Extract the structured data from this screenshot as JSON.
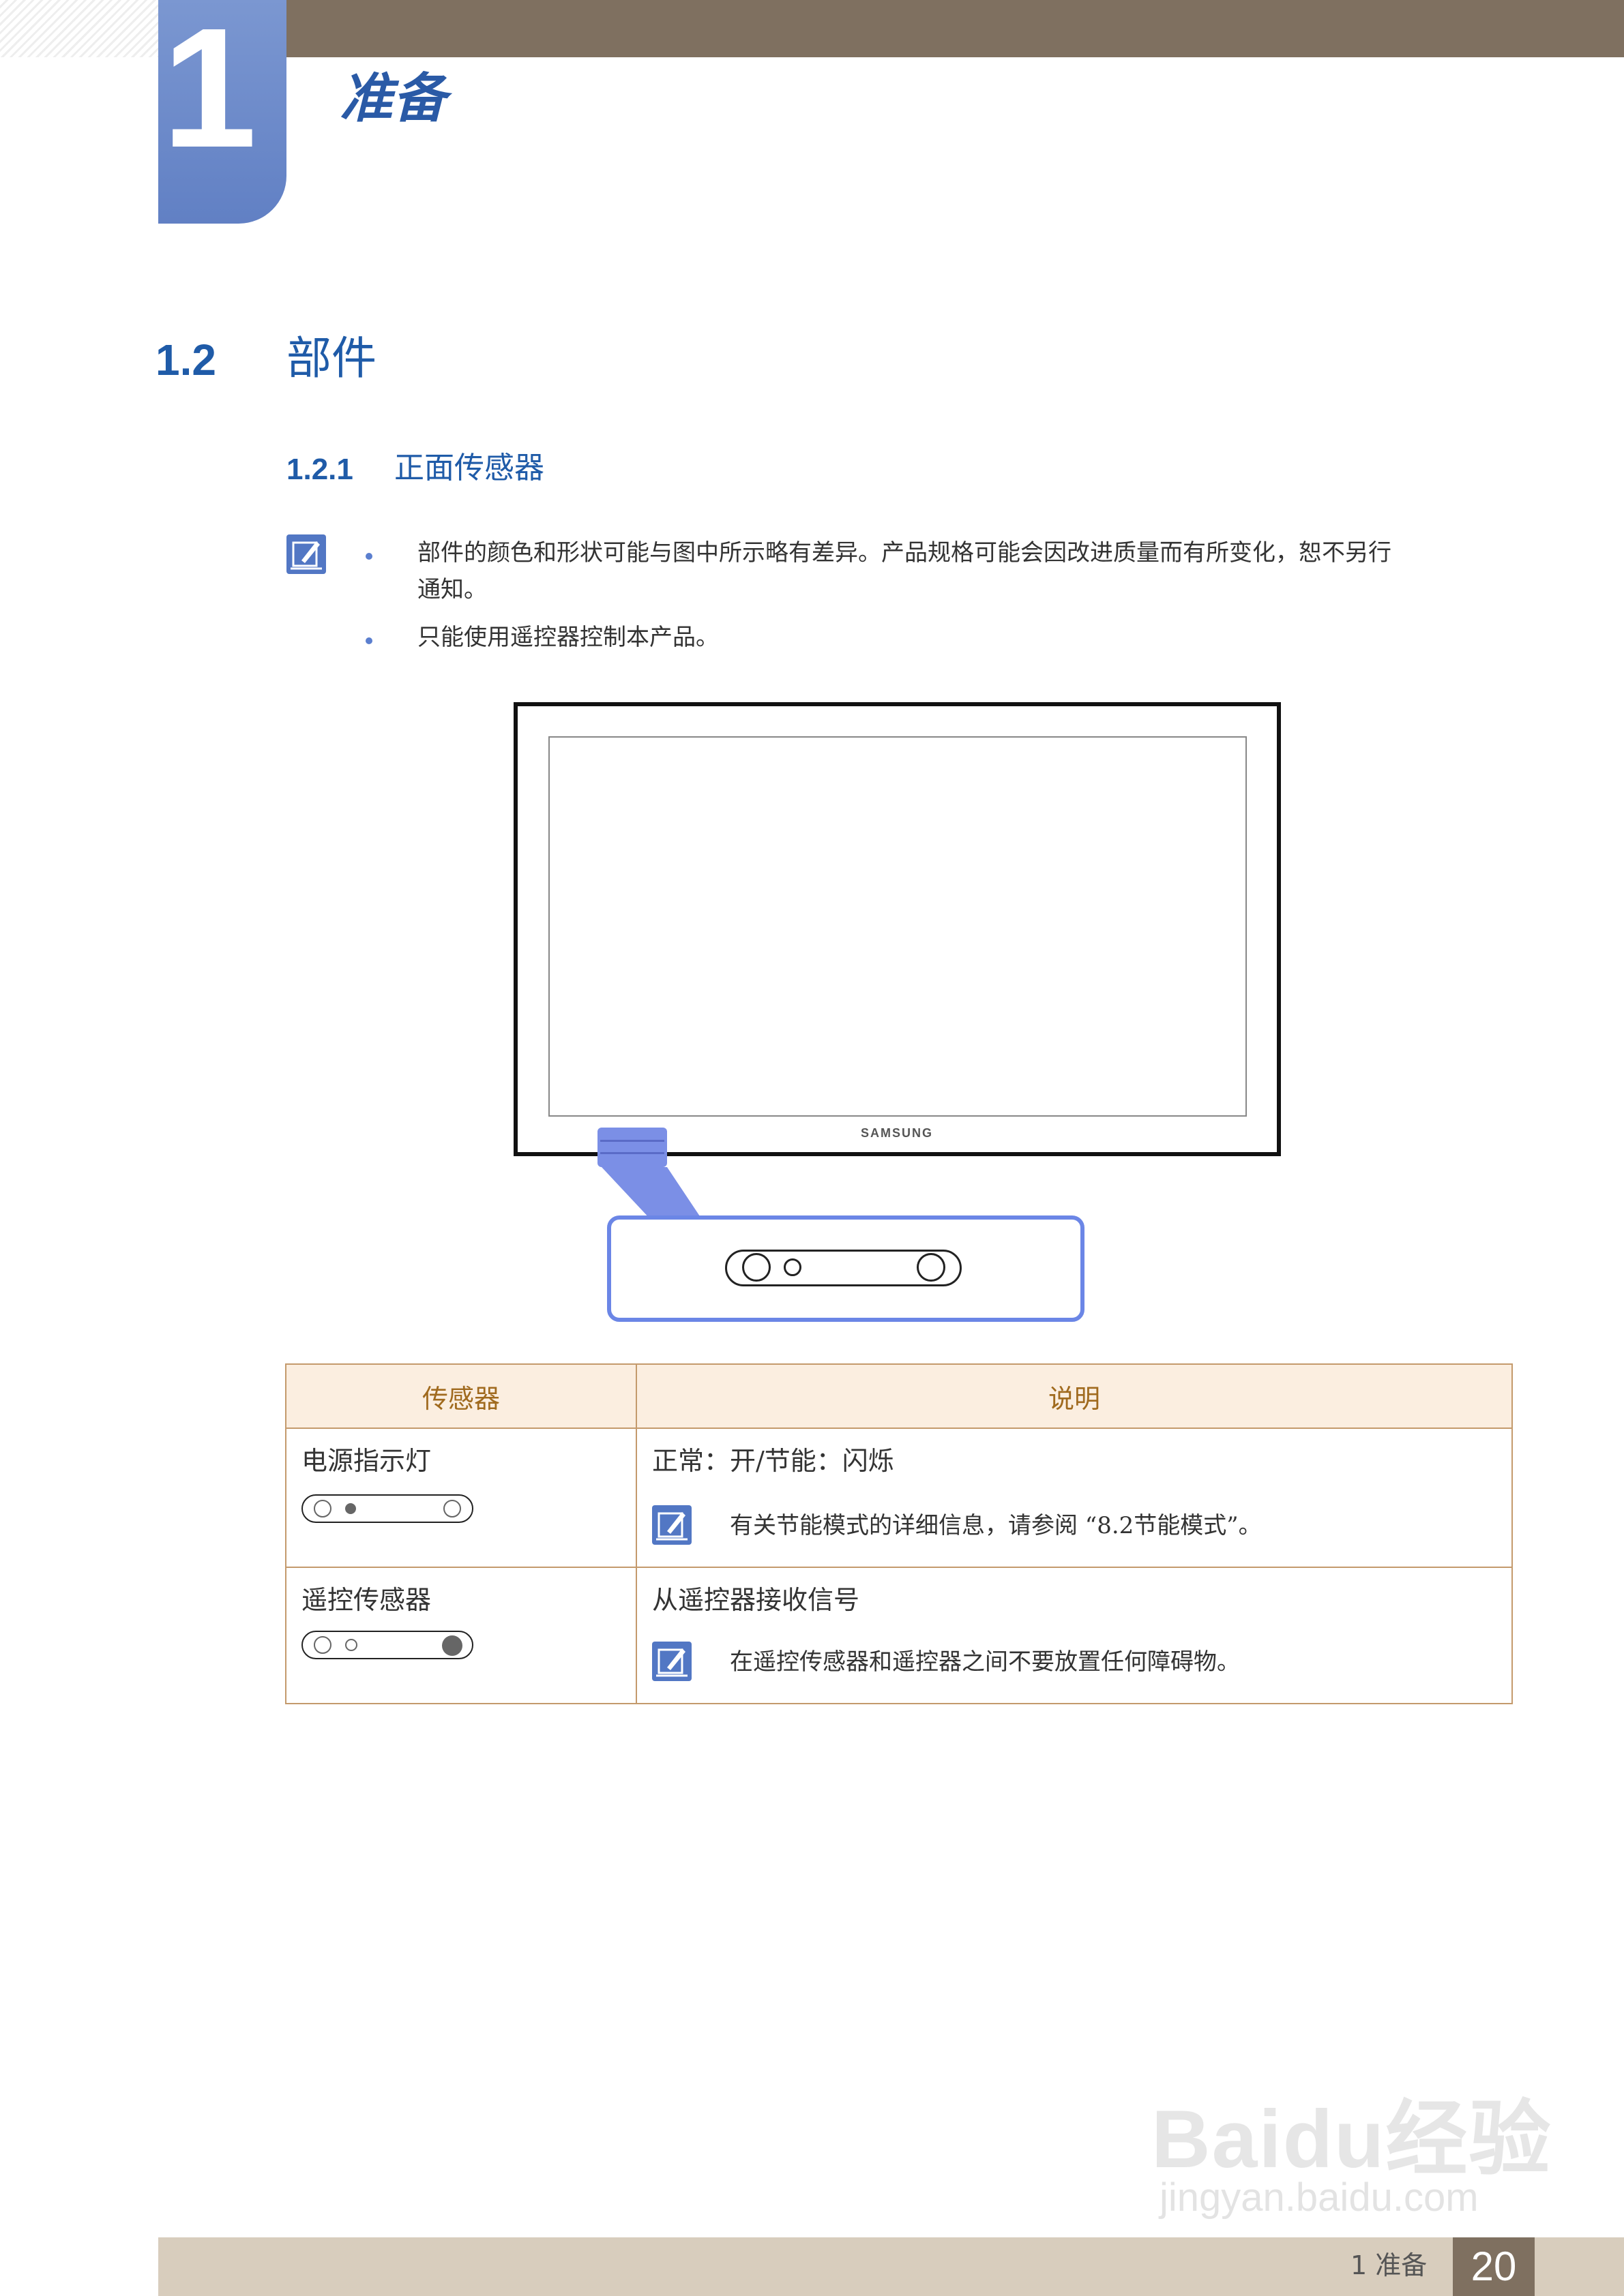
{
  "chapter": {
    "number": "1",
    "title": "准备"
  },
  "section": {
    "number": "1.2",
    "title": "部件"
  },
  "subsection": {
    "number": "1.2.1",
    "title": "正面传感器"
  },
  "notes": [
    {
      "line1": "部件的颜色和形状可能与图中所示略有差异。产品规格可能会因改进质量而有所变化，恕不另行",
      "line2": "通知。"
    },
    {
      "line1": "只能使用遥控器控制本产品。"
    }
  ],
  "figure": {
    "brand": "SAMSUNG"
  },
  "table": {
    "headers": [
      "传感器",
      "说明"
    ],
    "rows": [
      {
        "sensor": "电源指示灯",
        "description": "正常：开/节能：闪烁",
        "note": "有关节能模式的详细信息，请参阅 “8.2节能模式”。"
      },
      {
        "sensor": "遥控传感器",
        "description": "从遥控器接收信号",
        "note": "在遥控传感器和遥控器之间不要放置任何障碍物。"
      }
    ]
  },
  "footer": {
    "chapter_label": "1 准备",
    "page": "20"
  },
  "watermark": {
    "brand": "Baidu经验",
    "url": "jingyan.baidu.com"
  },
  "colors": {
    "accent_blue": "#1f5ba8",
    "top_bar": "#7f7060",
    "table_border": "#c49a6c",
    "table_header_bg": "#fbeee0",
    "highlight": "#6b86e6"
  }
}
